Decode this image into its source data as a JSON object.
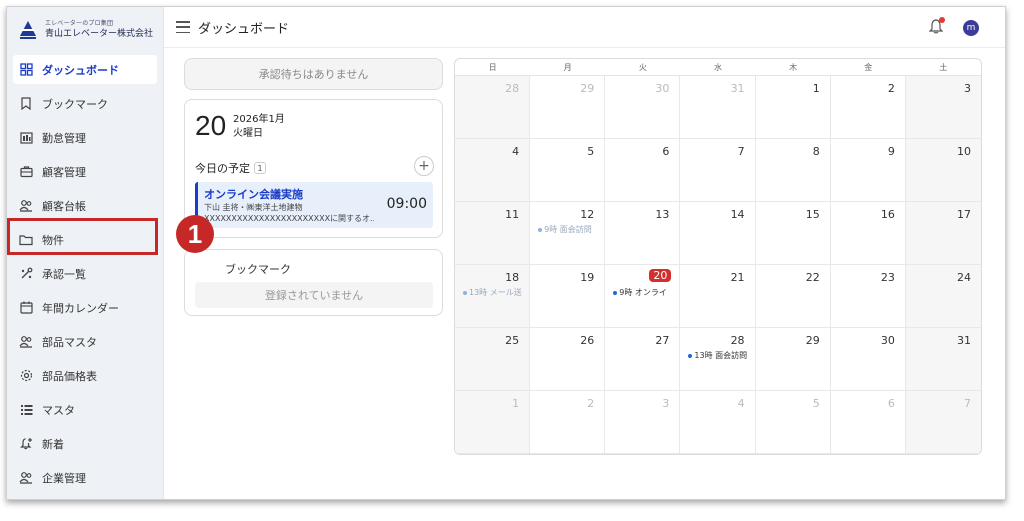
{
  "sidebar": {
    "logo_sub": "エレベーターのプロ集団",
    "logo_main": "青山エレベーター株式会社",
    "items": [
      {
        "label": "ダッシュボード",
        "icon": "grid-icon"
      },
      {
        "label": "ブックマーク",
        "icon": "bookmark-icon"
      },
      {
        "label": "勤怠管理",
        "icon": "attendance-icon"
      },
      {
        "label": "顧客管理",
        "icon": "briefcase-icon"
      },
      {
        "label": "顧客台帳",
        "icon": "users-icon"
      },
      {
        "label": "物件",
        "icon": "folder-icon"
      },
      {
        "label": "承認一覧",
        "icon": "approval-icon"
      },
      {
        "label": "年間カレンダー",
        "icon": "calendar-icon"
      },
      {
        "label": "部品マスタ",
        "icon": "users-icon"
      },
      {
        "label": "部品価格表",
        "icon": "gear-icon"
      },
      {
        "label": "マスタ",
        "icon": "list-icon"
      },
      {
        "label": "新着",
        "icon": "bell-plus-icon"
      },
      {
        "label": "企業管理",
        "icon": "users-icon"
      }
    ]
  },
  "callout": {
    "number": "1"
  },
  "header": {
    "title": "ダッシュボード",
    "avatar_initial": "m"
  },
  "pending": {
    "text": "承認待ちはありません"
  },
  "today": {
    "day": "20",
    "year_month": "2026年1月",
    "weekday": "火曜日",
    "schedule_label": "今日の予定",
    "schedule_count": "1",
    "add_label": "+",
    "event": {
      "title": "オンライン会議実施",
      "sub1": "下山 圭将・㈱東洋土地建物",
      "sub2": "XXXXXXXXXXXXXXXXXXXXXXXに関するオ...",
      "time": "09:00"
    }
  },
  "bookmark": {
    "title": "ブックマーク",
    "empty": "登録されていません"
  },
  "calendar": {
    "weekdays": [
      "日",
      "月",
      "火",
      "水",
      "木",
      "金",
      "土"
    ],
    "days": [
      {
        "n": "28",
        "out": true
      },
      {
        "n": "29",
        "out": true
      },
      {
        "n": "30",
        "out": true
      },
      {
        "n": "31",
        "out": true
      },
      {
        "n": "1"
      },
      {
        "n": "2"
      },
      {
        "n": "3"
      },
      {
        "n": "4"
      },
      {
        "n": "5"
      },
      {
        "n": "6"
      },
      {
        "n": "7"
      },
      {
        "n": "8"
      },
      {
        "n": "9"
      },
      {
        "n": "10"
      },
      {
        "n": "11"
      },
      {
        "n": "12",
        "ev": "9時 面会訪問",
        "faded": true
      },
      {
        "n": "13"
      },
      {
        "n": "14"
      },
      {
        "n": "15"
      },
      {
        "n": "16"
      },
      {
        "n": "17"
      },
      {
        "n": "18",
        "ev": "13時 メール送",
        "faded": true
      },
      {
        "n": "19"
      },
      {
        "n": "20",
        "today": true,
        "ev": "9時 オンライ"
      },
      {
        "n": "21"
      },
      {
        "n": "22"
      },
      {
        "n": "23"
      },
      {
        "n": "24"
      },
      {
        "n": "25"
      },
      {
        "n": "26"
      },
      {
        "n": "27"
      },
      {
        "n": "28",
        "ev": "13時 面会訪問"
      },
      {
        "n": "29"
      },
      {
        "n": "30"
      },
      {
        "n": "31"
      },
      {
        "n": "1",
        "out": true
      },
      {
        "n": "2",
        "out": true
      },
      {
        "n": "3",
        "out": true
      },
      {
        "n": "4",
        "out": true
      },
      {
        "n": "5",
        "out": true
      },
      {
        "n": "6",
        "out": true
      },
      {
        "n": "7",
        "out": true
      }
    ]
  },
  "colors": {
    "accent": "#1a3cc8",
    "highlight": "#c62828",
    "today": "#d32f2f"
  }
}
